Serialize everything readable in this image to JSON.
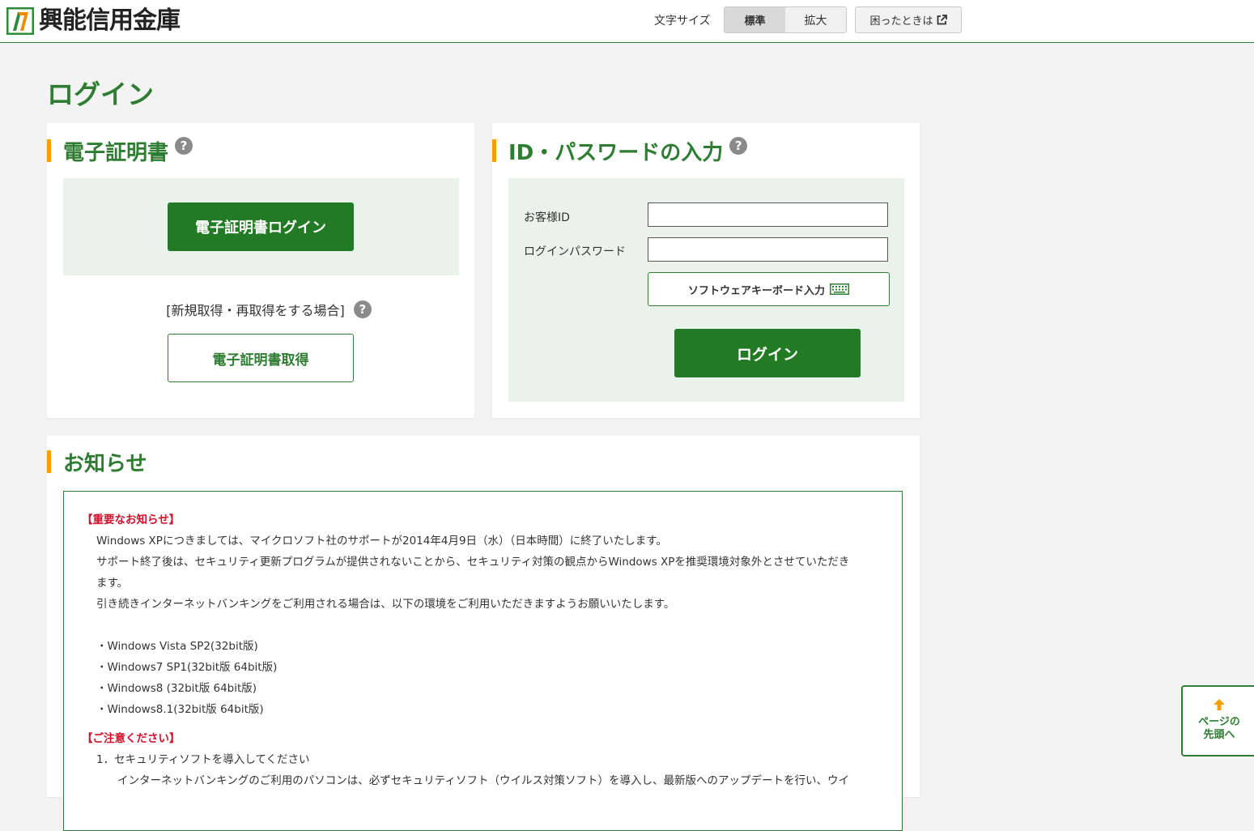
{
  "header": {
    "bank_name": "興能信用金庫",
    "font_size_label": "文字サイズ",
    "font_size_standard": "標準",
    "font_size_large": "拡大",
    "help_label": "困ったときは"
  },
  "page_title": "ログイン",
  "cert_panel": {
    "heading": "電子証明書",
    "login_button": "電子証明書ログイン",
    "new_cert_note": "[新規取得・再取得をする場合]",
    "get_cert_button": "電子証明書取得"
  },
  "id_panel": {
    "heading": "ID・パスワードの入力",
    "customer_id_label": "お客様ID",
    "customer_id_value": "",
    "password_label": "ログインパスワード",
    "password_value": "",
    "software_keyboard_button": "ソフトウェアキーボード入力",
    "login_button": "ログイン"
  },
  "notice": {
    "heading": "お知らせ",
    "important_title": "【重要なお知らせ】",
    "lines": [
      "Windows XPにつきましては、マイクロソフト社のサポートが2014年4月9日（水）（日本時間）に終了いたします。",
      "サポート終了後は、セキュリティ更新プログラムが提供されないことから、セキュリティ対策の観点からWindows XPを推奨環境対象外とさせていただき",
      "ます。",
      "引き続きインターネットバンキングをご利用される場合は、以下の環境をご利用いただきますようお願いいたします。"
    ],
    "os_list": [
      "・Windows Vista SP2(32bit版)",
      "・Windows7 SP1(32bit版 64bit版)",
      "・Windows8 (32bit版 64bit版)",
      "・Windows8.1(32bit版 64bit版)"
    ],
    "caution_title": "【ご注意ください】",
    "caution_item": "1．セキュリティソフトを導入してください",
    "caution_detail": "インターネットバンキングのご利用のパソコンは、必ずセキュリティソフト（ウイルス対策ソフト）を導入し、最新版へのアップデートを行い、ウイ"
  },
  "back_to_top": {
    "line1": "ページの",
    "line2": "先頭へ"
  },
  "colors": {
    "brand_green": "#2f7d32",
    "accent_orange": "#f5a000",
    "notice_red": "#d0112b"
  }
}
